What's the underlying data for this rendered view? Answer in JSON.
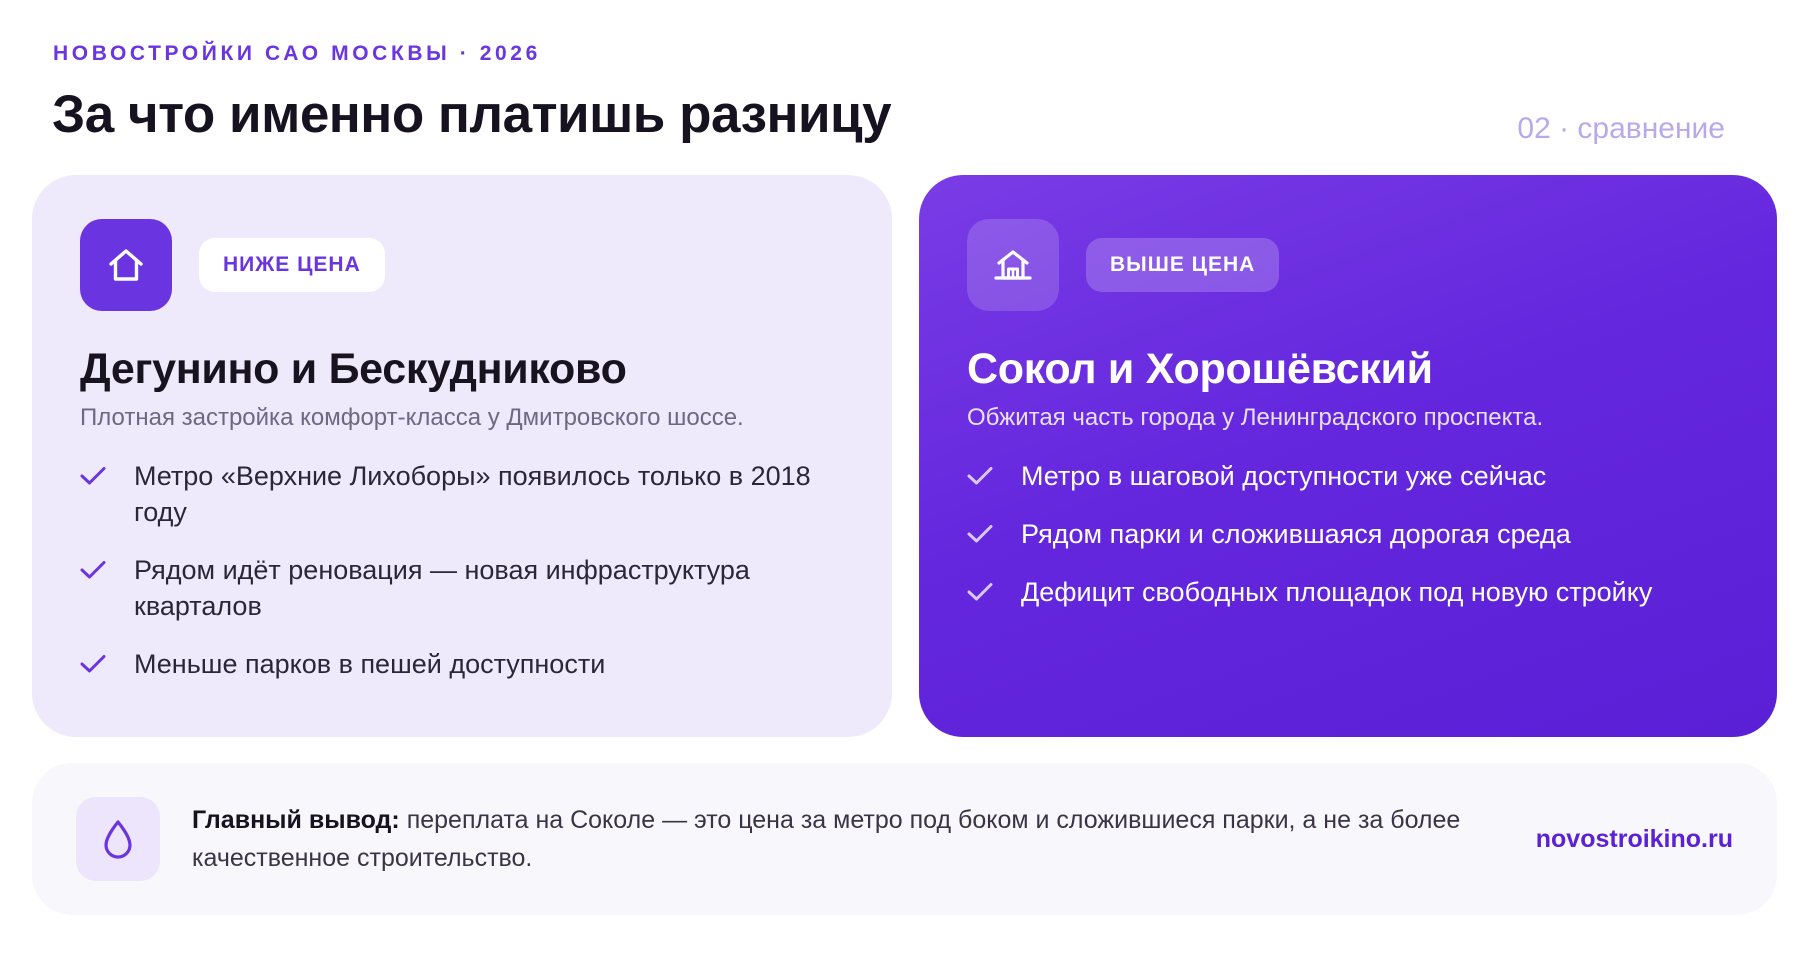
{
  "header": {
    "kicker": "НОВОСТРОЙКИ САО МОСКВЫ · 2026",
    "title": "За что именно платишь разницу",
    "slide_label": "02 · сравнение"
  },
  "cards": [
    {
      "icon": "house-icon",
      "badge": "НИЖЕ ЦЕНА",
      "title": "Дегунино и Бескудниково",
      "subtitle": "Плотная застройка комфорт-класса у Дмитровского шоссе.",
      "items": [
        "Метро «Верхние Лихоборы» появилось только в 2018 году",
        "Рядом идёт реновация — новая инфраструктура кварталов",
        "Меньше парков в пешей доступности"
      ]
    },
    {
      "icon": "building-icon",
      "badge": "ВЫШЕ ЦЕНА",
      "title": "Сокол и Хорошёвский",
      "subtitle": "Обжитая часть города у Ленинградского проспекта.",
      "items": [
        "Метро в шаговой доступности уже сейчас",
        "Рядом парки и сложившаяся дорогая среда",
        "Дефицит свободных площадок под новую стройку"
      ]
    }
  ],
  "conclusion": {
    "icon": "drop-icon",
    "label": "Главный вывод:",
    "text": " переплата на Соколе — это цена за метро под боком и сложившиеся парки, а не за более качественное строительство.",
    "site": "novostroikino.ru"
  },
  "colors": {
    "accent": "#6a34e0",
    "card_low_bg": "#efe9fc",
    "card_high_bg": "#6427dd",
    "muted": "#b8a9ea"
  }
}
